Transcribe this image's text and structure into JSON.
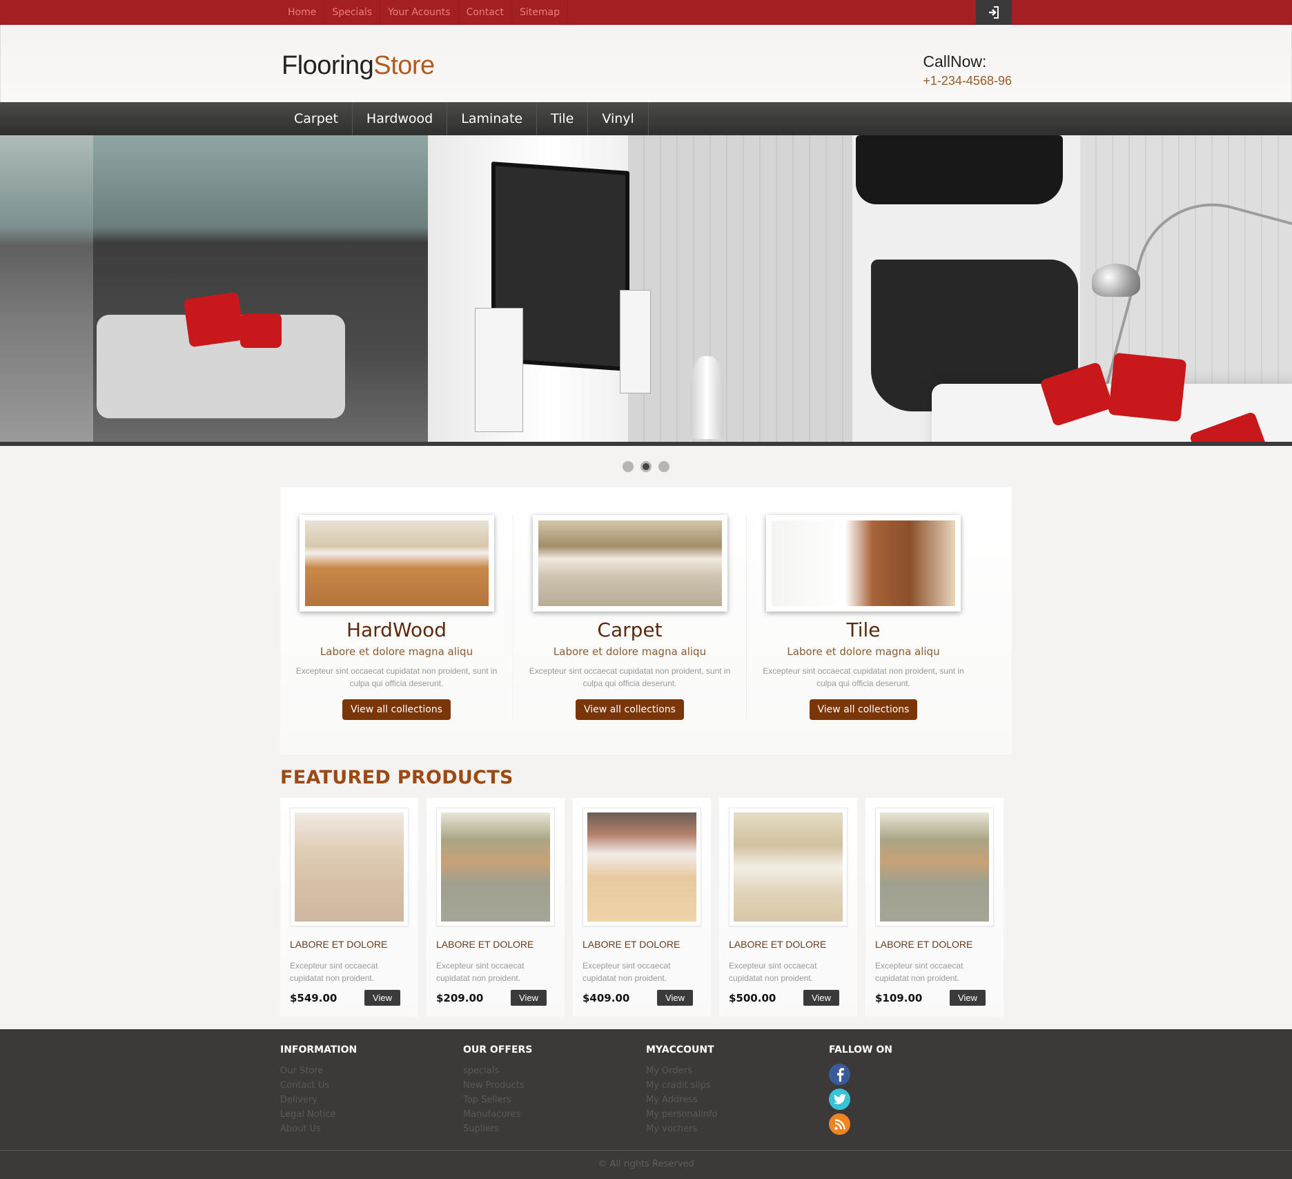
{
  "topnav": {
    "items": [
      {
        "label": "Home"
      },
      {
        "label": "Specials"
      },
      {
        "label": "Your Acounts"
      },
      {
        "label": "Contact"
      },
      {
        "label": "Sitemap"
      }
    ],
    "login_icon": "sign-in-icon"
  },
  "header": {
    "logo_part1": "Flooring",
    "logo_part2": "Store",
    "call_label": "CallNow:",
    "call_number": "+1-234-4568-96"
  },
  "mainnav": {
    "items": [
      {
        "label": "Carpet"
      },
      {
        "label": "Hardwood"
      },
      {
        "label": "Laminate"
      },
      {
        "label": "Tile"
      },
      {
        "label": "Vinyl"
      }
    ]
  },
  "slider": {
    "slide_count": 3,
    "active_index": 1
  },
  "collections": [
    {
      "title": "HardWood",
      "subtitle": "Labore et dolore magna aliqu",
      "description": "Excepteur sint occaecat cupidatat non proident, sunt in culpa qui officia deserunt.",
      "button": "View all collections"
    },
    {
      "title": "Carpet",
      "subtitle": "Labore et dolore magna aliqu",
      "description": "Excepteur sint occaecat cupidatat non proident, sunt in culpa qui officia deserunt.",
      "button": "View all collections"
    },
    {
      "title": "Tile",
      "subtitle": "Labore et dolore magna aliqu",
      "description": "Excepteur sint occaecat cupidatat non proident, sunt in culpa qui officia deserunt.",
      "button": "View all collections"
    }
  ],
  "featured": {
    "title": "FEATURED PRODUCTS",
    "products": [
      {
        "name": "LABORE ET DOLORE",
        "description": "Excepteur sint occaecat cupidatat non proident.",
        "price": "$549.00",
        "button": "View"
      },
      {
        "name": "LABORE ET DOLORE",
        "description": "Excepteur sint occaecat cupidatat non proident.",
        "price": "$209.00",
        "button": "View"
      },
      {
        "name": "LABORE ET DOLORE",
        "description": "Excepteur sint occaecat cupidatat non proident.",
        "price": "$409.00",
        "button": "View"
      },
      {
        "name": "LABORE ET DOLORE",
        "description": "Excepteur sint occaecat cupidatat non proident.",
        "price": "$500.00",
        "button": "View"
      },
      {
        "name": "LABORE ET DOLORE",
        "description": "Excepteur sint occaecat cupidatat non proident.",
        "price": "$109.00",
        "button": "View"
      }
    ]
  },
  "footer": {
    "information": {
      "title": "INFORMATION",
      "links": [
        "Our Store",
        "Contact Us",
        "Delivery",
        "Legal Notice",
        "About Us"
      ]
    },
    "offers": {
      "title": "OUR OFFERS",
      "links": [
        "specials",
        "New Products",
        "Top Sellers",
        "Manufacures",
        "Supliers"
      ]
    },
    "account": {
      "title": "MYACCOUNT",
      "links": [
        "My Orders",
        "My cradit slips",
        "My Address",
        "My personalinfo",
        "My vochers"
      ]
    },
    "follow": {
      "title": "FALLOW ON",
      "networks": [
        {
          "name": "facebook-icon",
          "glyph": "f",
          "color": "#3a5a9a"
        },
        {
          "name": "twitter-icon",
          "glyph": "t",
          "color": "#39c3d6"
        },
        {
          "name": "rss-icon",
          "glyph": "◔",
          "color": "#ef8520"
        }
      ]
    },
    "copyright": "© All rights Reserved"
  },
  "colors": {
    "topbar": "#a31f21",
    "accent_brown": "#7a3509",
    "logo_accent": "#b35a1e",
    "footer_bg": "#3b3a38"
  }
}
